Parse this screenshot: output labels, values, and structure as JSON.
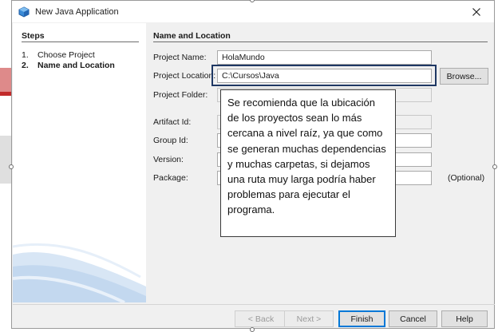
{
  "window": {
    "title": "New Java Application",
    "close_glyph": "✕",
    "icon": "netbeans-cube-icon"
  },
  "steps": {
    "heading": "Steps",
    "items": [
      {
        "num": "1.",
        "label": "Choose Project",
        "active": false
      },
      {
        "num": "2.",
        "label": "Name and Location",
        "active": true
      }
    ]
  },
  "form": {
    "heading": "Name and Location",
    "project_name": {
      "label": "Project Name:",
      "value": "HolaMundo"
    },
    "project_location": {
      "label": "Project Location:",
      "value": "C:\\Cursos\\Java",
      "browse_label": "Browse..."
    },
    "project_folder": {
      "label": "Project Folder:",
      "value": ""
    },
    "artifact_id": {
      "label": "Artifact Id:",
      "value": ""
    },
    "group_id": {
      "label": "Group Id:",
      "value": ""
    },
    "version": {
      "label": "Version:",
      "value": ""
    },
    "package": {
      "label": "Package:",
      "value": "",
      "optional_label": "(Optional)"
    }
  },
  "callout": {
    "text": "Se recomienda que la ubicación de los proyectos sean lo más cercana a nivel raíz, ya que como se generan muchas dependencias y muchas carpetas, si dejamos una ruta muy larga podría haber problemas para ejecutar el programa."
  },
  "buttons": {
    "back": "< Back",
    "next": "Next >",
    "finish": "Finish",
    "cancel": "Cancel",
    "help": "Help"
  },
  "colors": {
    "accent": "#0078d7",
    "highlight_box": "#1f3864"
  }
}
